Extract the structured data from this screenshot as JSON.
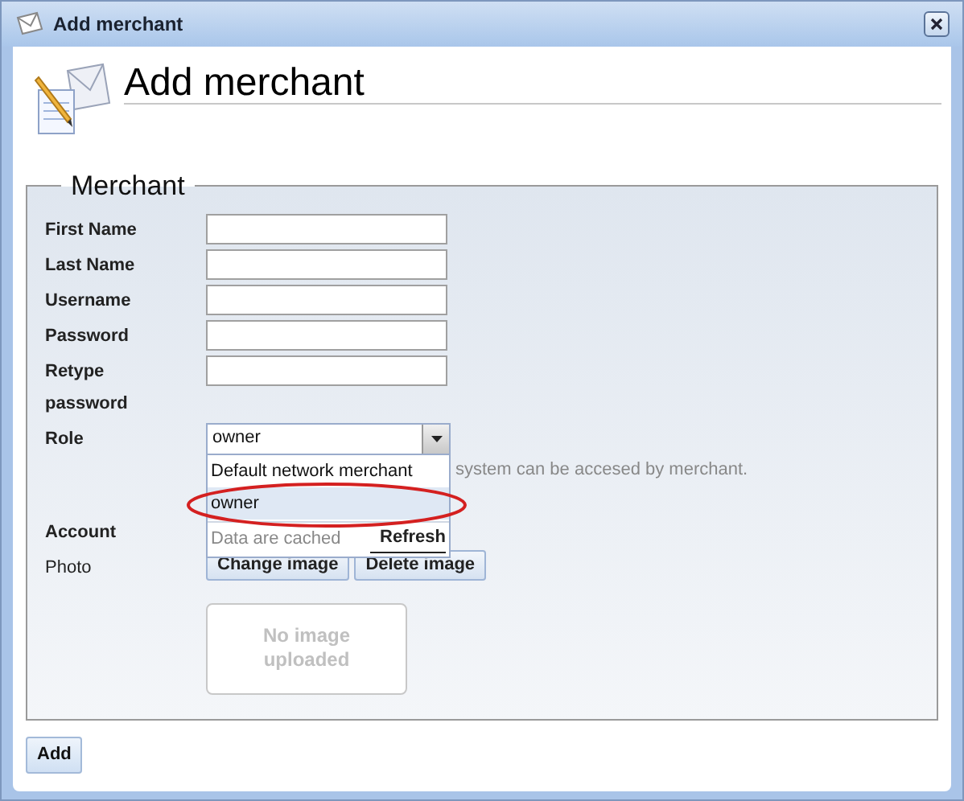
{
  "window": {
    "title": "Add merchant"
  },
  "header": {
    "title": "Add merchant"
  },
  "fieldset": {
    "legend": "Merchant",
    "fields": [
      {
        "label": "First Name"
      },
      {
        "label": "Last Name"
      },
      {
        "label": "Username"
      },
      {
        "label": "Password"
      },
      {
        "label": "Retype password"
      }
    ],
    "role": {
      "label": "Role",
      "value": "owner",
      "expanded": true,
      "options": [
        {
          "label": "Default network merchant",
          "selected": false
        },
        {
          "label": "owner",
          "selected": true
        }
      ],
      "cache_note": "Data are cached",
      "refresh": "Refresh",
      "hint": "system can be accesed by merchant."
    },
    "account": {
      "label": "Account"
    },
    "photo": {
      "label": "Photo",
      "buttons": [
        "Change image",
        "Delete image"
      ],
      "empty_text": "No image uploaded"
    }
  },
  "buttons": [
    "Add"
  ]
}
